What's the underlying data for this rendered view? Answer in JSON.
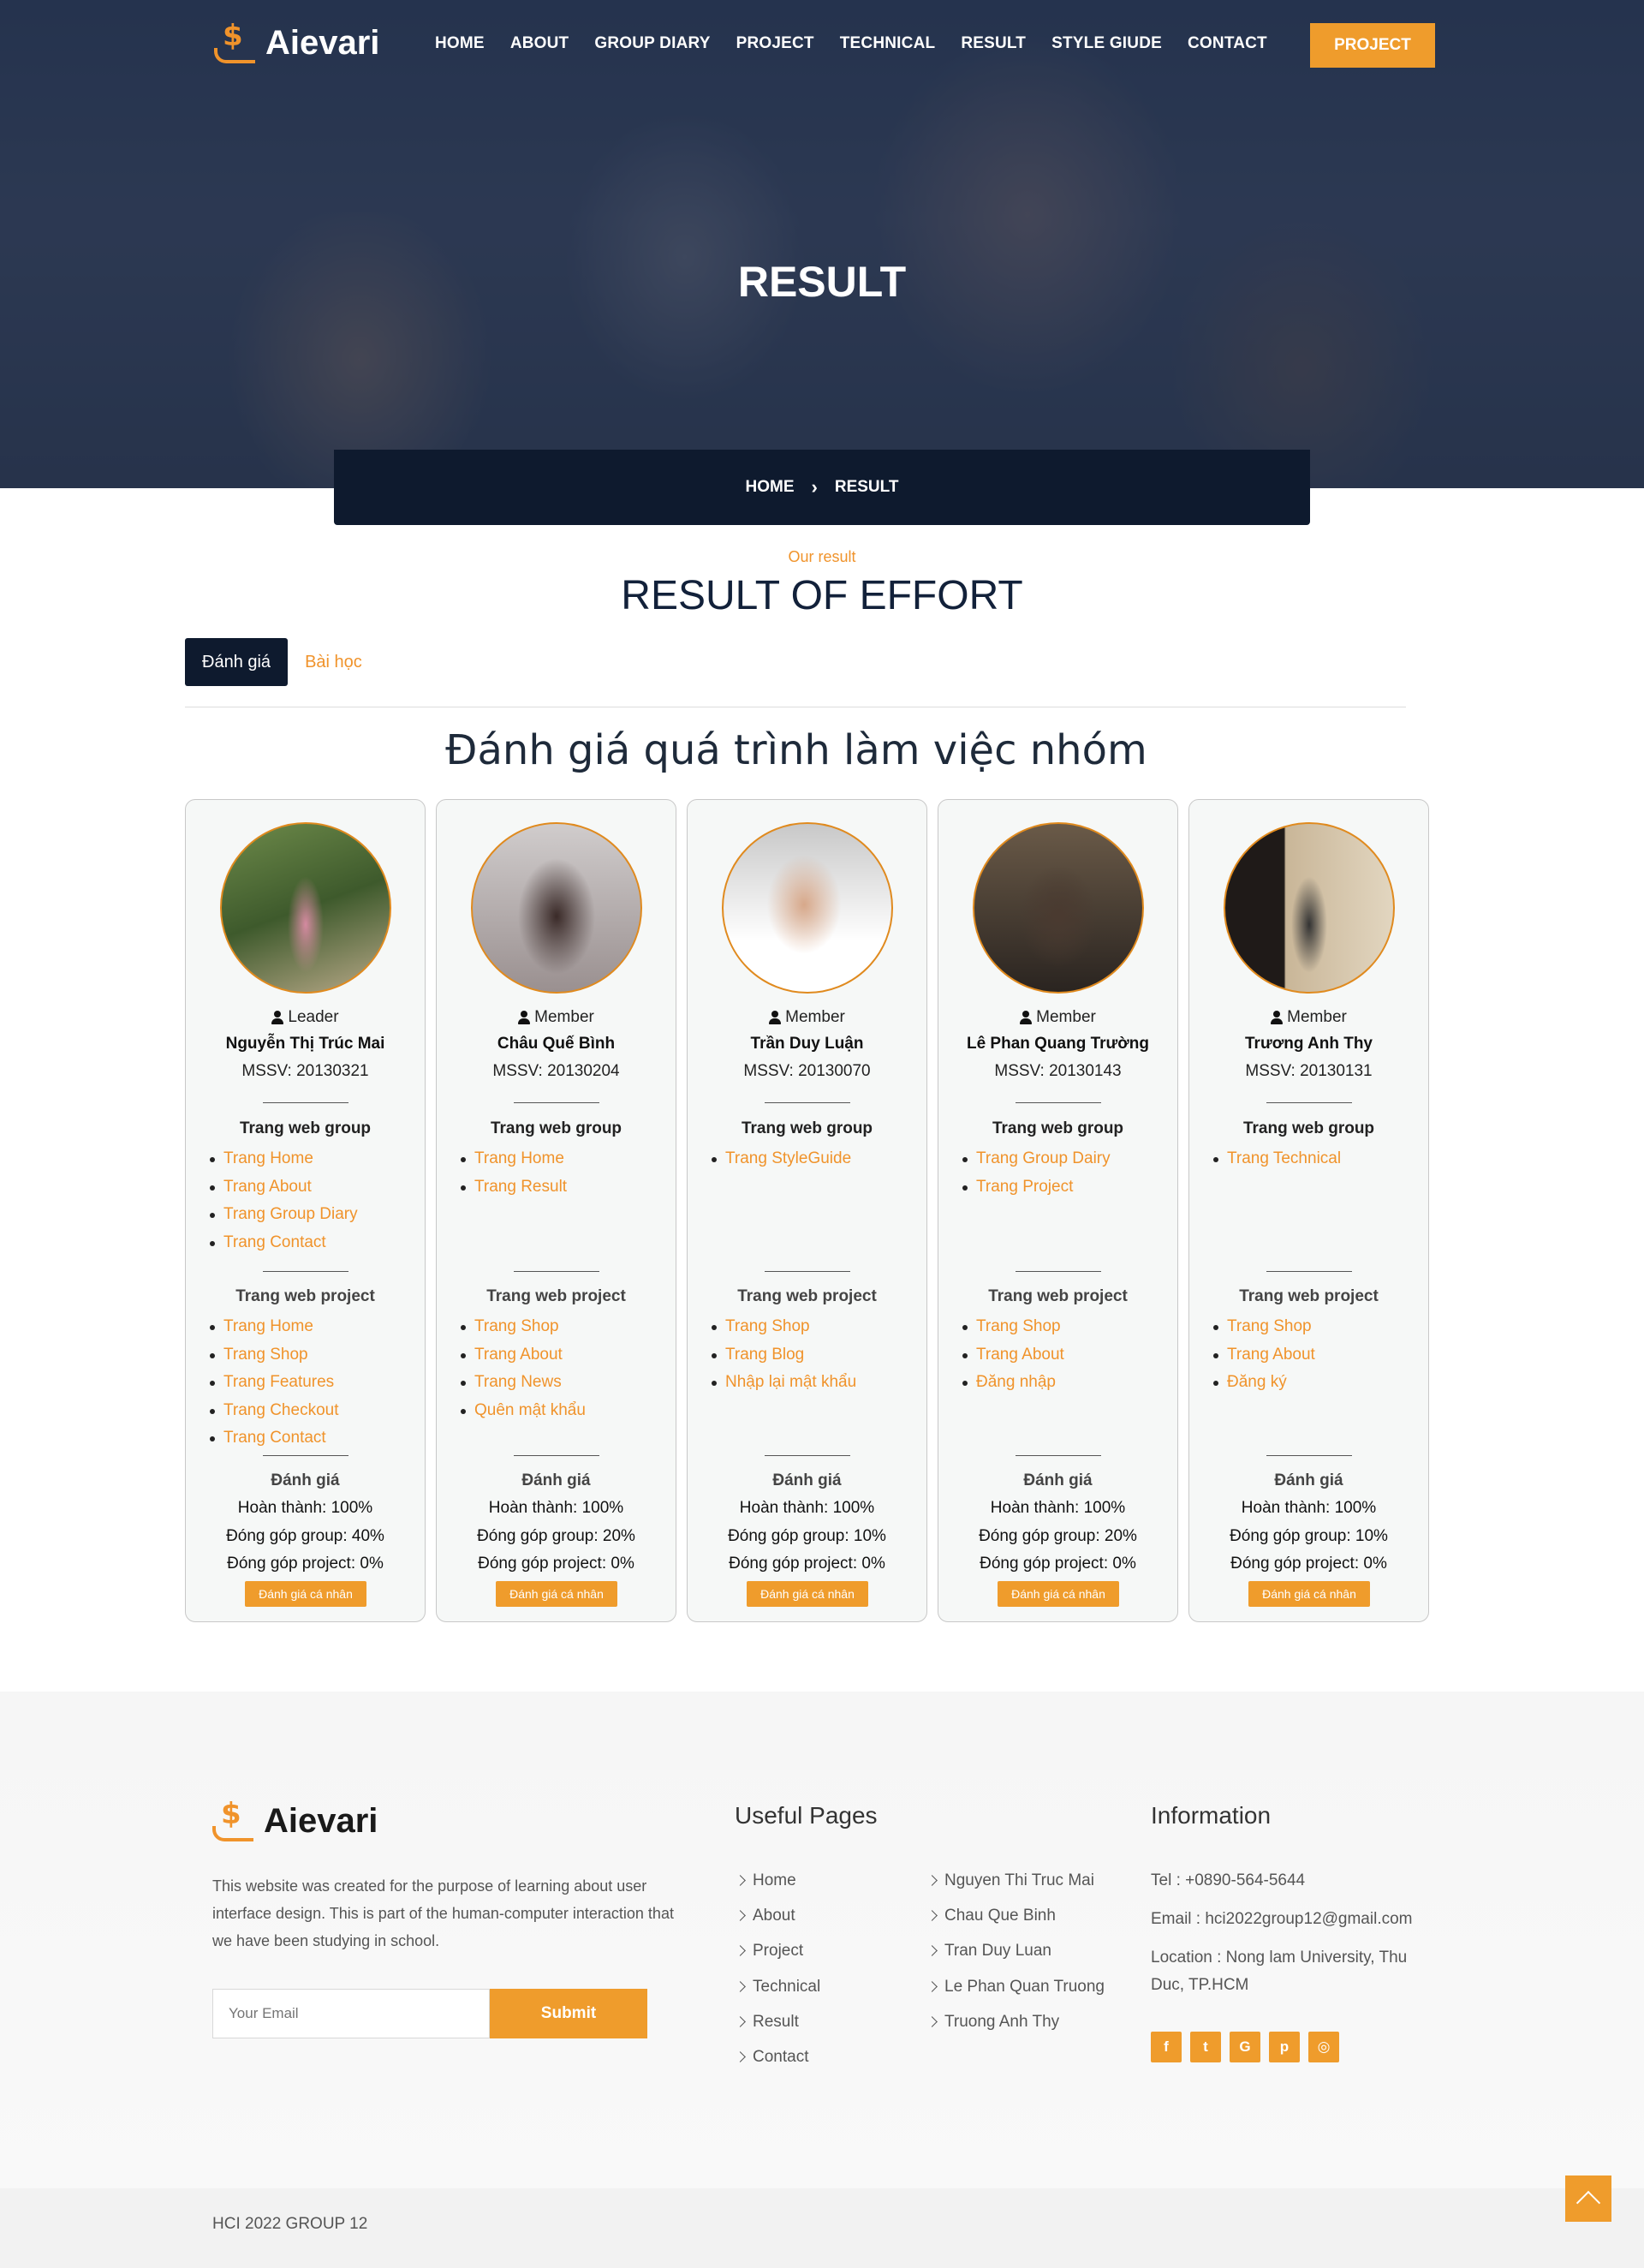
{
  "brand": {
    "name": "Aievari",
    "accent": "#ef9c2c",
    "dark": "#0e1a2e"
  },
  "nav": {
    "items": [
      "HOME",
      "ABOUT",
      "GROUP DIARY",
      "PROJECT",
      "TECHNICAL",
      "RESULT",
      "STYLE GIUDE",
      "CONTACT"
    ],
    "cta": "PROJECT"
  },
  "hero": {
    "title": "RESULT"
  },
  "breadcrumb": {
    "home": "HOME",
    "current": "RESULT"
  },
  "section": {
    "subtitle": "Our result",
    "title": "RESULT OF EFFORT",
    "tabs": [
      "Đánh giá",
      "Bài học"
    ],
    "heading": "Đánh giá quá trình làm việc nhóm"
  },
  "members": [
    {
      "role": "Leader",
      "name": "Nguyễn Thị Trúc Mai",
      "mssv": "MSSV: 20130321",
      "group_label": "Trang web group",
      "group_pages": [
        "Trang Home",
        "Trang About",
        "Trang Group Diary",
        "Trang Contact"
      ],
      "project_label": "Trang web project",
      "project_pages": [
        "Trang Home",
        "Trang Shop",
        "Trang Features",
        "Trang Checkout",
        "Trang Contact"
      ],
      "eval_label": "Đánh giá",
      "done": "Hoàn thành: 100%",
      "group_contrib": "Đóng góp group: 40%",
      "project_contrib": "Đóng góp project: 0%",
      "button": "Đánh giá cá nhân"
    },
    {
      "role": "Member",
      "name": "Châu Quế Bình",
      "mssv": "MSSV: 20130204",
      "group_label": "Trang web group",
      "group_pages": [
        "Trang Home",
        "Trang Result"
      ],
      "project_label": "Trang web project",
      "project_pages": [
        "Trang Shop",
        "Trang About",
        "Trang News",
        "Quên mật khẩu"
      ],
      "eval_label": "Đánh giá",
      "done": "Hoàn thành: 100%",
      "group_contrib": "Đóng góp group: 20%",
      "project_contrib": "Đóng góp project: 0%",
      "button": "Đánh giá cá nhân"
    },
    {
      "role": "Member",
      "name": "Trần Duy Luận",
      "mssv": "MSSV: 20130070",
      "group_label": "Trang web group",
      "group_pages": [
        "Trang StyleGuide"
      ],
      "project_label": "Trang web project",
      "project_pages": [
        "Trang Shop",
        "Trang Blog",
        "Nhập lại mật khẩu"
      ],
      "eval_label": "Đánh giá",
      "done": "Hoàn thành: 100%",
      "group_contrib": "Đóng góp group: 10%",
      "project_contrib": "Đóng góp project: 0%",
      "button": "Đánh giá cá nhân"
    },
    {
      "role": "Member",
      "name": "Lê Phan Quang Trường",
      "mssv": "MSSV: 20130143",
      "group_label": "Trang web group",
      "group_pages": [
        "Trang Group Dairy",
        "Trang Project"
      ],
      "project_label": "Trang web project",
      "project_pages": [
        "Trang Shop",
        "Trang About",
        "Đăng nhập"
      ],
      "eval_label": "Đánh giá",
      "done": "Hoàn thành: 100%",
      "group_contrib": "Đóng góp group: 20%",
      "project_contrib": "Đóng góp project: 0%",
      "button": "Đánh giá cá nhân"
    },
    {
      "role": "Member",
      "name": "Trương Anh Thy",
      "mssv": "MSSV: 20130131",
      "group_label": "Trang web group",
      "group_pages": [
        "Trang Technical"
      ],
      "project_label": "Trang web project",
      "project_pages": [
        "Trang Shop",
        "Trang About",
        "Đăng ký"
      ],
      "eval_label": "Đánh giá",
      "done": "Hoàn thành: 100%",
      "group_contrib": "Đóng góp group: 10%",
      "project_contrib": "Đóng góp project: 0%",
      "button": "Đánh giá cá nhân"
    }
  ],
  "footer": {
    "about": "This website was created for the purpose of learning about user interface design. This is part of the human-computer interaction that we have been studying in school.",
    "email_placeholder": "Your Email",
    "submit": "Submit",
    "useful_title": "Useful Pages",
    "useful_links": [
      "Home",
      "About",
      "Project",
      "Technical",
      "Result",
      "Contact"
    ],
    "member_links": [
      "Nguyen Thi Truc Mai",
      "Chau Que Binh",
      "Tran Duy Luan",
      "Le Phan Quan Truong",
      "Truong Anh Thy"
    ],
    "info_title": "Information",
    "tel": "Tel : +0890-564-5644",
    "email": "Email : hci2022group12@gmail.com",
    "location": "Location : Nong lam University, Thu Duc, TP.HCM",
    "socials": [
      "facebook-icon",
      "twitter-icon",
      "google-icon",
      "pinterest-icon",
      "instagram-icon"
    ],
    "copyright": "HCI 2022 GROUP 12"
  }
}
